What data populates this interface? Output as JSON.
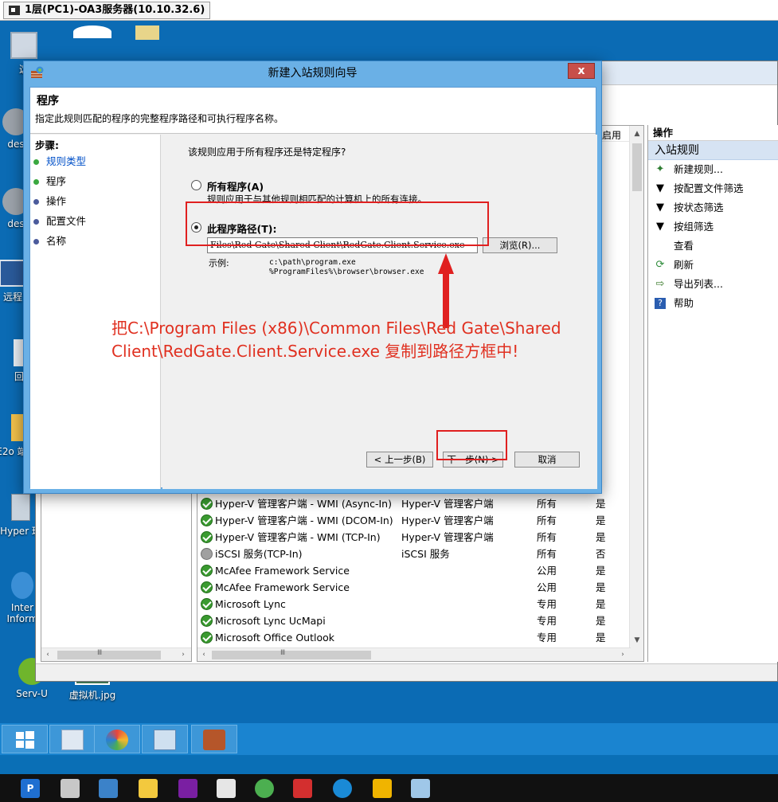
{
  "rdp": {
    "tab_title": "1层(PC1)-OA3服务器(10.10.32.6)"
  },
  "desktop": {
    "icons": [
      {
        "label": "这"
      },
      {
        "label": "des"
      },
      {
        "label": "des"
      },
      {
        "label": "远程"
      },
      {
        "label": "回"
      },
      {
        "label": "E2o 端3.1"
      },
      {
        "label": "Hyper 理"
      },
      {
        "label": "Inter Inform"
      },
      {
        "label": "Serv-U"
      },
      {
        "label": "虚拟机.jpg"
      }
    ]
  },
  "firewall": {
    "list_header": {
      "enabled": "启用"
    },
    "rows": [
      {
        "name": "Hyper-V 管理客户端 - WMI (Async-In)",
        "group": "Hyper-V 管理客户端",
        "profile": "所有",
        "enabled": "是",
        "status": "on"
      },
      {
        "name": "Hyper-V 管理客户端 - WMI (DCOM-In)",
        "group": "Hyper-V 管理客户端",
        "profile": "所有",
        "enabled": "是",
        "status": "on"
      },
      {
        "name": "Hyper-V 管理客户端 - WMI (TCP-In)",
        "group": "Hyper-V 管理客户端",
        "profile": "所有",
        "enabled": "是",
        "status": "on"
      },
      {
        "name": "iSCSI 服务(TCP-In)",
        "group": "iSCSI 服务",
        "profile": "所有",
        "enabled": "否",
        "status": "off"
      },
      {
        "name": "McAfee Framework Service",
        "group": "",
        "profile": "公用",
        "enabled": "是",
        "status": "on"
      },
      {
        "name": "McAfee Framework Service",
        "group": "",
        "profile": "公用",
        "enabled": "是",
        "status": "on"
      },
      {
        "name": "Microsoft Lync",
        "group": "",
        "profile": "专用",
        "enabled": "是",
        "status": "on"
      },
      {
        "name": "Microsoft Lync UcMapi",
        "group": "",
        "profile": "专用",
        "enabled": "是",
        "status": "on"
      },
      {
        "name": "Microsoft Office Outlook",
        "group": "",
        "profile": "专用",
        "enabled": "是",
        "status": "on"
      }
    ],
    "scroll_glyph": "Ⅲ",
    "actions": {
      "header": "操作",
      "section": "入站规则",
      "items": [
        {
          "label": "新建规则...",
          "icon": "new-rule-icon"
        },
        {
          "label": "按配置文件筛选",
          "icon": "filter-icon"
        },
        {
          "label": "按状态筛选",
          "icon": "filter-icon"
        },
        {
          "label": "按组筛选",
          "icon": "filter-icon"
        },
        {
          "label": "查看",
          "icon": "none"
        },
        {
          "label": "刷新",
          "icon": "refresh-icon"
        },
        {
          "label": "导出列表...",
          "icon": "export-icon"
        },
        {
          "label": "帮助",
          "icon": "help-icon"
        }
      ]
    }
  },
  "wizard": {
    "title": "新建入站规则向导",
    "close": "x",
    "page_title": "程序",
    "page_desc": "指定此规则匹配的程序的完整程序路径和可执行程序名称。",
    "steps_title": "步骤:",
    "steps": [
      "规则类型",
      "程序",
      "操作",
      "配置文件",
      "名称"
    ],
    "question": "该规则应用于所有程序还是特定程序?",
    "all_programs": {
      "label": "所有程序(A)",
      "desc": "规则应用于与其他规则相匹配的计算机上的所有连接。"
    },
    "this_program": {
      "label": "此程序路径(T):"
    },
    "path_value": "Files\\Red Gate\\Shared Client\\RedGate.Client.Service.exe",
    "browse": "浏览(R)...",
    "example_label": "示例:",
    "example_text": "c:\\path\\program.exe\n%ProgramFiles%\\browser\\browser.exe",
    "back": "< 上一步(B)",
    "next": "下一步(N) >",
    "cancel": "取消"
  },
  "annotation": "把C:\\Program Files (x86)\\Common Files\\Red Gate\\Shared Client\\RedGate.Client.Service.exe 复制到路径方框中!",
  "colors": {
    "annotation": "#e03020",
    "highlight": "#e02020",
    "desktop": "#0b6bb4",
    "taskbar": "#1a84d0"
  }
}
